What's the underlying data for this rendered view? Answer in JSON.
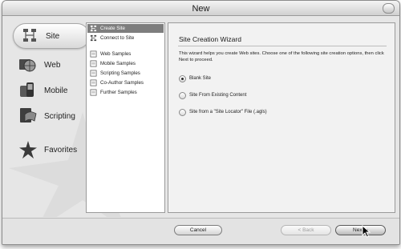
{
  "window": {
    "title": "New"
  },
  "categories": [
    {
      "label": "Site",
      "icon": "site-icon",
      "selected": true
    },
    {
      "label": "Web",
      "icon": "web-icon",
      "selected": false
    },
    {
      "label": "Mobile",
      "icon": "mobile-icon",
      "selected": false
    },
    {
      "label": "Scripting",
      "icon": "scripting-icon",
      "selected": false
    },
    {
      "label": "Favorites",
      "icon": "star-icon",
      "selected": false
    }
  ],
  "list": [
    {
      "label": "Create Site",
      "selected": true
    },
    {
      "label": "Connect to Site",
      "selected": false
    },
    {
      "label": "Web Samples",
      "selected": false
    },
    {
      "label": "Mobile Samples",
      "selected": false
    },
    {
      "label": "Scripting Samples",
      "selected": false
    },
    {
      "label": "Co-Author Samples",
      "selected": false
    },
    {
      "label": "Further Samples",
      "selected": false
    }
  ],
  "wizard": {
    "title": "Site Creation Wizard",
    "description": "This wizard helps you create Web sites. Choose one of the following site creation options, then click Next to proceed.",
    "options": [
      {
        "label": "Blank Site",
        "checked": true
      },
      {
        "label": "Site From Existing Content",
        "checked": false
      },
      {
        "label": "Site from a \"Site Locator\" File (.agls)",
        "checked": false
      }
    ]
  },
  "buttons": {
    "cancel": "Cancel",
    "back": "< Back",
    "next": "Next >"
  }
}
